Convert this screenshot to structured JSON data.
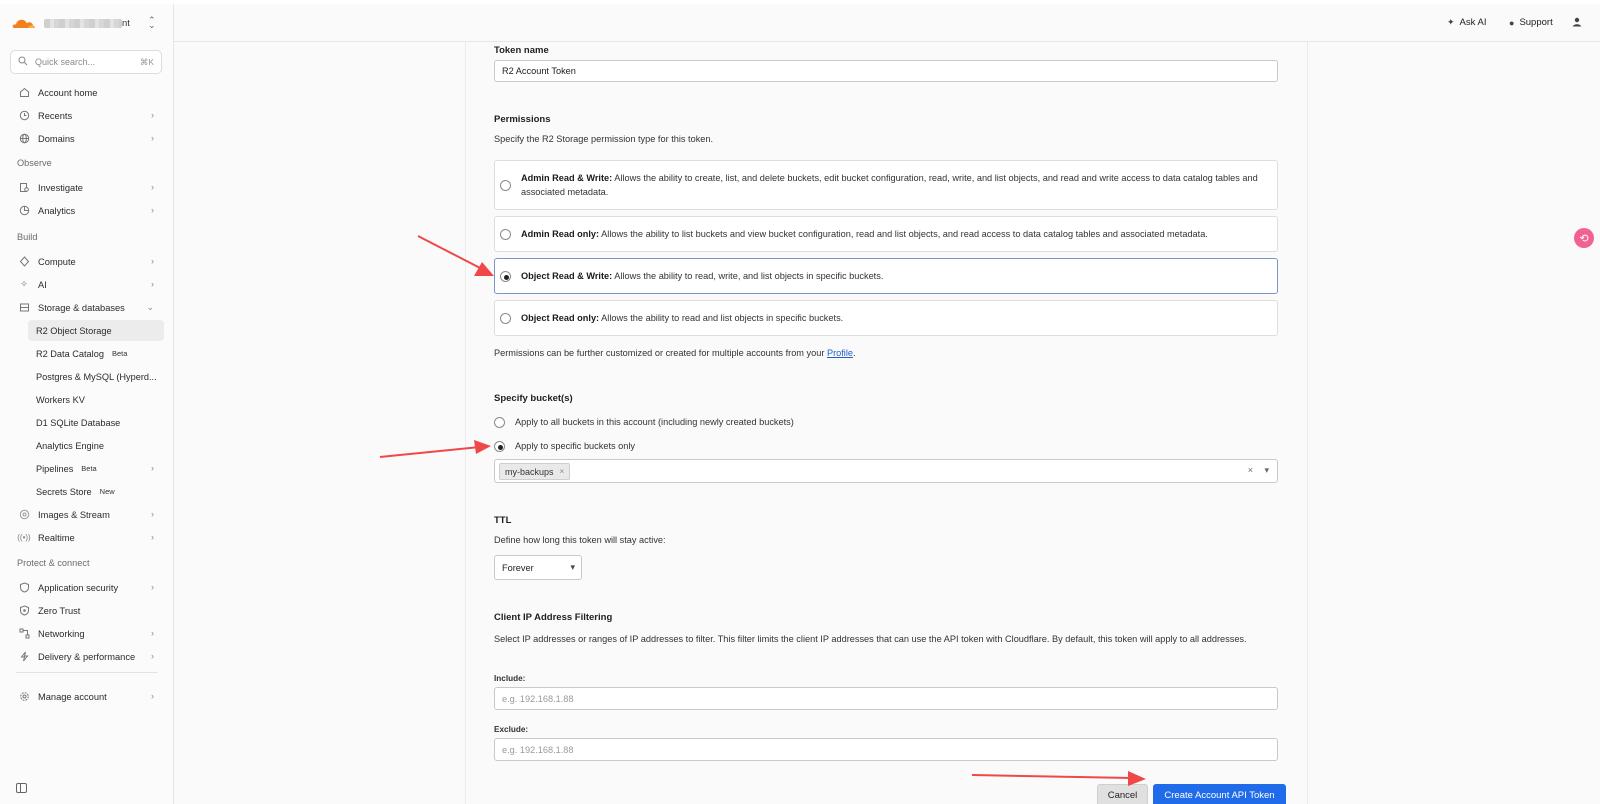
{
  "sidebar": {
    "account_suffix": "nt",
    "search": {
      "placeholder": "Quick search...",
      "shortcut": "⌘K"
    },
    "items": {
      "account_home": "Account home",
      "recents": "Recents",
      "domains": "Domains",
      "observe": "Observe",
      "investigate": "Investigate",
      "analytics": "Analytics",
      "build": "Build",
      "compute": "Compute",
      "ai": "AI",
      "storage": "Storage & databases",
      "r2_object_storage": "R2 Object Storage",
      "r2_data_catalog": "R2 Data Catalog",
      "r2_data_catalog_badge": "Beta",
      "postgres": "Postgres & MySQL (Hyperd...",
      "workers_kv": "Workers KV",
      "d1": "D1 SQLite Database",
      "analytics_engine": "Analytics Engine",
      "pipelines": "Pipelines",
      "pipelines_badge": "Beta",
      "secrets_store": "Secrets Store",
      "secrets_store_badge": "New",
      "images_stream": "Images & Stream",
      "realtime": "Realtime",
      "protect": "Protect & connect",
      "app_security": "Application security",
      "zero_trust": "Zero Trust",
      "networking": "Networking",
      "delivery": "Delivery & performance",
      "manage_account": "Manage account"
    }
  },
  "topbar": {
    "ask_ai": "Ask AI",
    "support": "Support"
  },
  "form": {
    "token_name_label": "Token name",
    "token_name_value": "R2 Account Token",
    "permissions_label": "Permissions",
    "permissions_desc": "Specify the R2 Storage permission type for this token.",
    "options": [
      {
        "title": "Admin Read & Write:",
        "desc": "Allows the ability to create, list, and delete buckets, edit bucket configuration, read, write, and list objects, and read and write access to data catalog tables and associated metadata."
      },
      {
        "title": "Admin Read only:",
        "desc": "Allows the ability to list buckets and view bucket configuration, read and list objects, and read access to data catalog tables and associated metadata."
      },
      {
        "title": "Object Read & Write:",
        "desc": "Allows the ability to read, write, and list objects in specific buckets."
      },
      {
        "title": "Object Read only:",
        "desc": "Allows the ability to read and list objects in specific buckets."
      }
    ],
    "permissions_note": "Permissions can be further customized or created for multiple accounts from your",
    "permissions_link": "Profile",
    "buckets_label": "Specify bucket(s)",
    "bucket_all": "Apply to all buckets in this account (including newly created buckets)",
    "bucket_specific": "Apply to specific buckets only",
    "bucket_tag": "my-backups",
    "ttl_label": "TTL",
    "ttl_desc": "Define how long this token will stay active:",
    "ttl_value": "Forever",
    "ip_label": "Client IP Address Filtering",
    "ip_desc": "Select IP addresses or ranges of IP addresses to filter. This filter limits the client IP addresses that can use the API token with Cloudflare. By default, this token will apply to all addresses.",
    "include_label": "Include:",
    "include_placeholder": "e.g. 192.168.1.88",
    "exclude_label": "Exclude:",
    "exclude_placeholder": "e.g. 192.168.1.88",
    "cancel": "Cancel",
    "create": "Create Account API Token"
  },
  "colors": {
    "accent": "#1f6bea",
    "annotation_arrow": "#f04848",
    "logo": "#f38020"
  }
}
